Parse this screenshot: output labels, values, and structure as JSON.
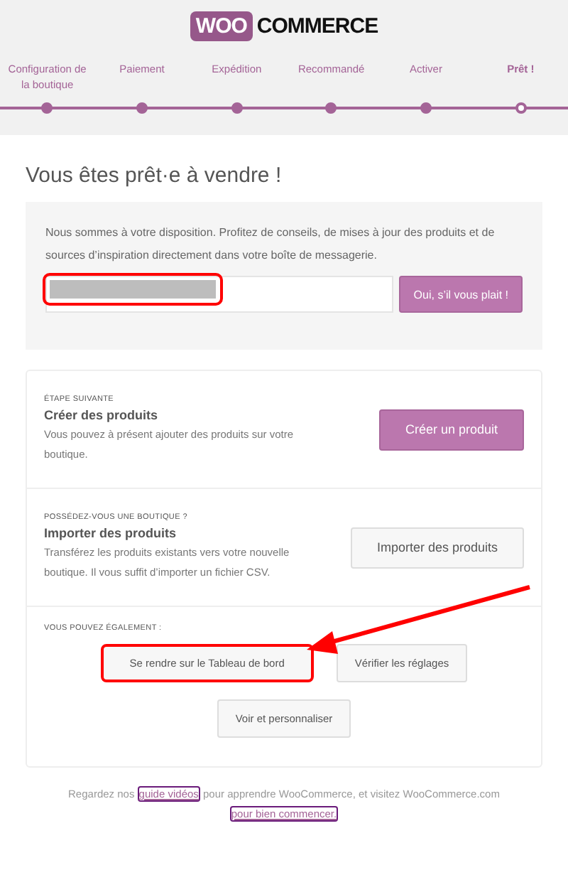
{
  "logo": {
    "badge": "WOO",
    "word": "COMMERCE"
  },
  "steps": [
    {
      "label": "Configuration de la boutique",
      "selected": false
    },
    {
      "label": "Paiement",
      "selected": false
    },
    {
      "label": "Expédition",
      "selected": false
    },
    {
      "label": "Recommandé",
      "selected": false
    },
    {
      "label": "Activer",
      "selected": false
    },
    {
      "label": "Prêt !",
      "selected": true
    }
  ],
  "title": "Vous êtes prêt·e à vendre !",
  "newsletter": {
    "text": "Nous sommes à votre disposition. Profitez de conseils, de mises à jour des produits et de sources d’inspiration directement dans votre boîte de messagerie.",
    "email_redacted": true,
    "button": "Oui, s’il vous plait !"
  },
  "sections": [
    {
      "eyebrow": "ÉTAPE SUIVANTE",
      "heading": "Créer des produits",
      "text": "Vous pouvez à présent ajouter des produits sur votre boutique.",
      "button": "Créer un produit",
      "kind": "primary"
    },
    {
      "eyebrow": "POSSÉDEZ-VOUS UNE BOUTIQUE ?",
      "heading": "Importer des produits",
      "text": "Transférez les produits existants vers votre nouvelle boutique. Il vous suffit d’importer un fichier CSV.",
      "button": "Importer des produits",
      "kind": "secondary"
    }
  ],
  "more": {
    "eyebrow": "VOUS POUVEZ ÉGALEMENT :",
    "buttons": [
      {
        "label": "Se rendre sur le Tableau de bord",
        "highlighted": true
      },
      {
        "label": "Vérifier les réglages",
        "highlighted": false
      },
      {
        "label": "Voir et personnaliser",
        "highlighted": false
      }
    ]
  },
  "footer": {
    "before": "Regardez nos ",
    "link1": "guide vidéos",
    "middle": " pour apprendre WooCommerce, et visitez WooCommerce.com ",
    "link2": "pour bien commencer."
  }
}
